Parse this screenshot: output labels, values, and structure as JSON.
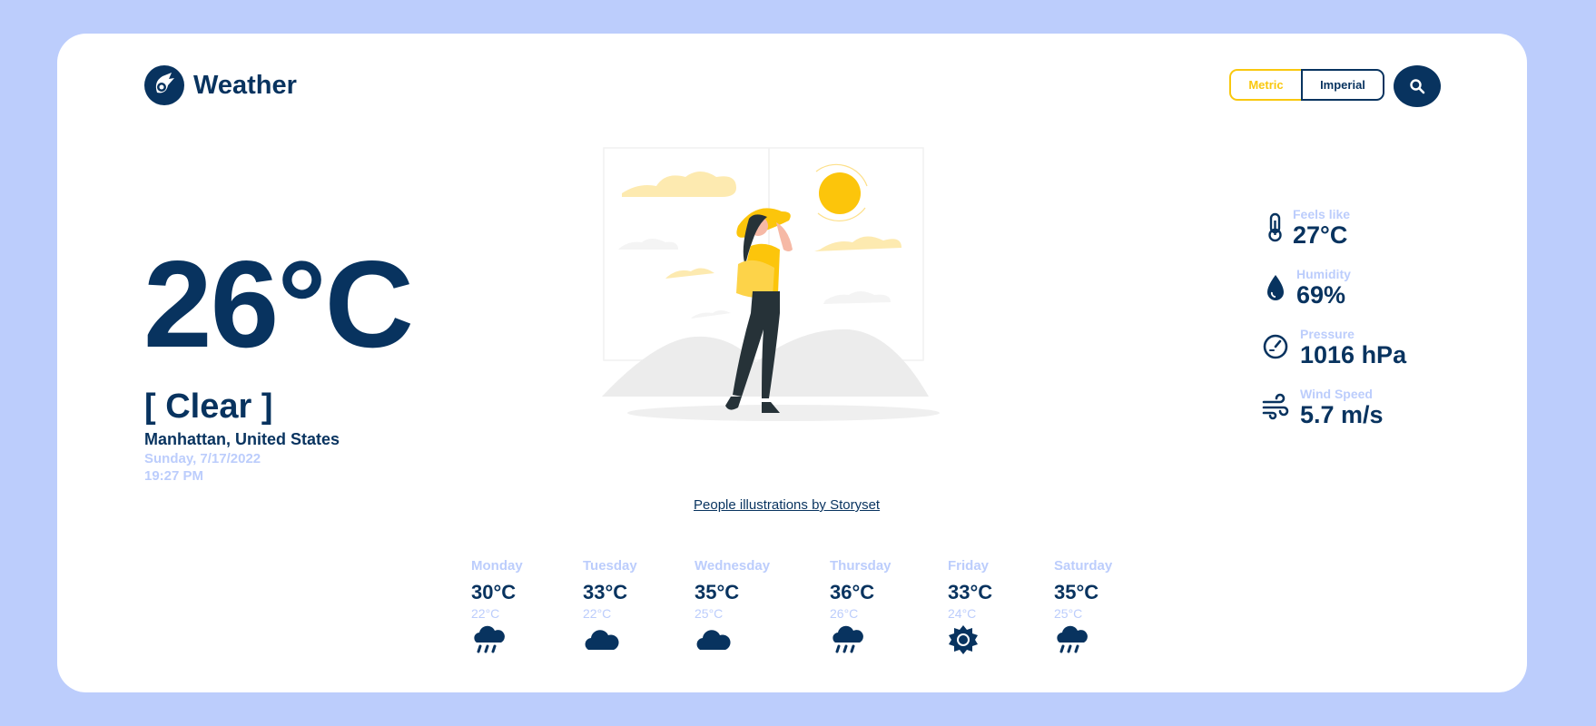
{
  "app": {
    "title": "Weather"
  },
  "units": {
    "metric_label": "Metric",
    "imperial_label": "Imperial",
    "selected": "Metric"
  },
  "current": {
    "temperature": "26°C",
    "condition": "[ Clear ]",
    "location": "Manhattan, United States",
    "date": "Sunday, 7/17/2022",
    "time": "19:27 PM"
  },
  "credit": {
    "text": "People illustrations by Storyset"
  },
  "details": [
    {
      "label": "Feels like",
      "value": "27°C",
      "icon": "thermometer-icon"
    },
    {
      "label": "Humidity",
      "value": "69%",
      "icon": "droplet-icon"
    },
    {
      "label": "Pressure",
      "value": "1016 hPa",
      "icon": "gauge-icon"
    },
    {
      "label": "Wind Speed",
      "value": "5.7 m/s",
      "icon": "wind-icon"
    }
  ],
  "forecast": [
    {
      "day": "Monday",
      "high": "30°C",
      "low": "22°C",
      "icon": "rain-cloud-icon"
    },
    {
      "day": "Tuesday",
      "high": "33°C",
      "low": "22°C",
      "icon": "cloud-icon"
    },
    {
      "day": "Wednesday",
      "high": "35°C",
      "low": "25°C",
      "icon": "cloud-icon"
    },
    {
      "day": "Thursday",
      "high": "36°C",
      "low": "26°C",
      "icon": "rain-cloud-icon"
    },
    {
      "day": "Friday",
      "high": "33°C",
      "low": "24°C",
      "icon": "sun-icon"
    },
    {
      "day": "Saturday",
      "high": "35°C",
      "low": "25°C",
      "icon": "rain-cloud-icon"
    }
  ],
  "colors": {
    "navy": "#08335f",
    "accent": "#f9c80e",
    "muted": "#bccdfc",
    "background": "#bccdfc"
  }
}
